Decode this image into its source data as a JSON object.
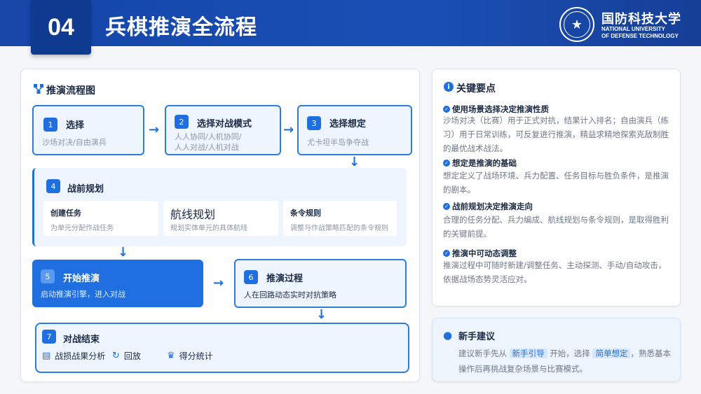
{
  "header": {
    "section_number": "04",
    "title": "兵棋推演全流程",
    "university_cn": "国防科技大学",
    "university_en_line1": "NATIONAL UNIVERSITY",
    "university_en_line2": "OF DEFENSE TECHNOLOGY"
  },
  "flow": {
    "title": "推演流程图",
    "steps": [
      {
        "num": "1",
        "title": "选择",
        "desc": "沙场对决/自由演兵"
      },
      {
        "num": "2",
        "title": "选择对战模式",
        "desc1": "人人协同/人机协同/",
        "desc2": "人人对战/人机对战"
      },
      {
        "num": "3",
        "title": "选择想定",
        "desc": "尤卡坦半岛争夺战"
      },
      {
        "num": "4",
        "title": "战前规划",
        "subs": [
          {
            "title": "创建任务",
            "desc": "为单元分配作战任务"
          },
          {
            "title": "航线规划",
            "desc": "规划实体单元的具体航线"
          },
          {
            "title": "条令规则",
            "desc": "调整与作战策略匹配的条令规则"
          }
        ]
      },
      {
        "num": "5",
        "title": "开始推演",
        "desc": "启动推演引擎，进入对战"
      },
      {
        "num": "6",
        "title": "推演过程",
        "desc": "人在回路动态实时对抗策略"
      },
      {
        "num": "7",
        "title": "对战结束",
        "items": [
          {
            "icon": "bar-chart-icon",
            "label": "战损战果分析"
          },
          {
            "icon": "replay-icon",
            "label": "回放"
          },
          {
            "icon": "trophy-icon",
            "label": "得分统计"
          }
        ]
      }
    ]
  },
  "key_points": {
    "title": "关键要点",
    "items": [
      {
        "head": "使用场景选择决定推演性质",
        "text": "沙场对决（比赛）用于正式对抗，结果计入排名；自由演兵（练习）用于日常训练，可反复进行推演，精益求精地探索克敌制胜的最优战术战法。"
      },
      {
        "head": "想定是推演的基础",
        "text": "想定定义了战场环境、兵力配置、任务目标与胜负条件，是推演的剧本。"
      },
      {
        "head": "战前规划决定推演走向",
        "text": "合理的任务分配、兵力编成、航线规划与条令规则，是取得胜利的关键前提。"
      },
      {
        "head": "推演中可动态调整",
        "text": "推演过程中可随时新建/调整任务、主动探测、手动/自动攻击，依据战场态势灵活应对。"
      }
    ]
  },
  "tip": {
    "title": "新手建议",
    "text_a": "建议新手先从",
    "hl1": "新手引导",
    "text_b": "开始，选择",
    "hl2": "简单想定",
    "text_c": "，熟悉基本操作后再挑战复杂场景与比赛模式。"
  },
  "colors": {
    "primary": "#1f6fe0",
    "header": "#1546a8"
  }
}
